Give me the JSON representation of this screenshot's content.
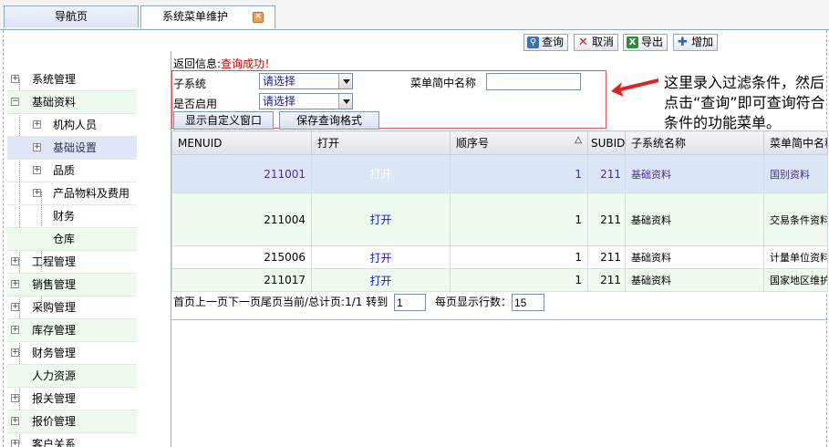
{
  "tabs": {
    "nav_label": "导航页",
    "active_label": "系统菜单维护",
    "close_glyph": "×"
  },
  "toolbar": {
    "query": "查询",
    "cancel": "取消",
    "export": "导出",
    "add": "增加"
  },
  "result": {
    "prefix": "返回信息:",
    "message": "查询成功！"
  },
  "filters": {
    "subsystem_label": "子系统",
    "subsystem_value": "请选择",
    "menu_name_label": "菜单简中名称",
    "menu_name_value": "",
    "enabled_label": "是否启用",
    "enabled_value": "请选择",
    "btn_custom_window": "显示自定义窗口",
    "btn_save_format": "保存查询格式"
  },
  "callout": {
    "text": "这里录入过滤条件，然后点击“查询”即可查询符合条件的功能菜单。"
  },
  "tree": {
    "items": [
      {
        "label": "系统管理",
        "exp": "+"
      },
      {
        "label": "基础资料",
        "exp": "−"
      },
      {
        "label": "机构人员",
        "exp": "+"
      },
      {
        "label": "基础设置",
        "exp": "+"
      },
      {
        "label": "品质",
        "exp": "+"
      },
      {
        "label": "产品物料及费用",
        "exp": "+"
      },
      {
        "label": "财务",
        "exp": ""
      },
      {
        "label": "仓库",
        "exp": ""
      },
      {
        "label": "工程管理",
        "exp": "+"
      },
      {
        "label": "销售管理",
        "exp": "+"
      },
      {
        "label": "采购管理",
        "exp": "+"
      },
      {
        "label": "库存管理",
        "exp": "+"
      },
      {
        "label": "财务管理",
        "exp": "+"
      },
      {
        "label": "人力资源",
        "exp": ""
      },
      {
        "label": "报关管理",
        "exp": "+"
      },
      {
        "label": "报价管理",
        "exp": "+"
      },
      {
        "label": "客户关系",
        "exp": "+"
      }
    ]
  },
  "grid": {
    "headers": {
      "menuid": "MENUID",
      "open": "打开",
      "order": "顺序号",
      "sort_icon": "△",
      "subid": "SUBID",
      "subsystem": "子系统名称",
      "menu_name": "菜单简中名称"
    },
    "rows": [
      {
        "menuid": "211001",
        "open": "打开",
        "order": "1",
        "subid": "211",
        "subsystem": "基础资料",
        "menu_name": "国别资料"
      },
      {
        "menuid": "211004",
        "open": "打开",
        "order": "1",
        "subid": "211",
        "subsystem": "基础资料",
        "menu_name": "交易条件资料"
      },
      {
        "menuid": "215006",
        "open": "打开",
        "order": "1",
        "subid": "211",
        "subsystem": "基础资料",
        "menu_name": "计量单位资料"
      },
      {
        "menuid": "211017",
        "open": "打开",
        "order": "1",
        "subid": "211",
        "subsystem": "基础资料",
        "menu_name": "国家地区维护"
      }
    ]
  },
  "pager": {
    "nav_text": "首页上一页下一页尾页当前/总计页:1/1 转到",
    "goto_value": "1",
    "rows_label": "每页显示行数：",
    "rows_value": "15"
  },
  "colors": {
    "accent_red": "#d40000",
    "selected_row": "#dde6f6",
    "alt_row": "#eefaee",
    "link": "#1a1ad0"
  },
  "icons": {
    "query": "search-icon",
    "cancel": "cancel-x-icon",
    "export": "excel-export-icon",
    "add": "plus-icon",
    "tab_close": "close-icon",
    "callout": "arrow-left-icon"
  }
}
